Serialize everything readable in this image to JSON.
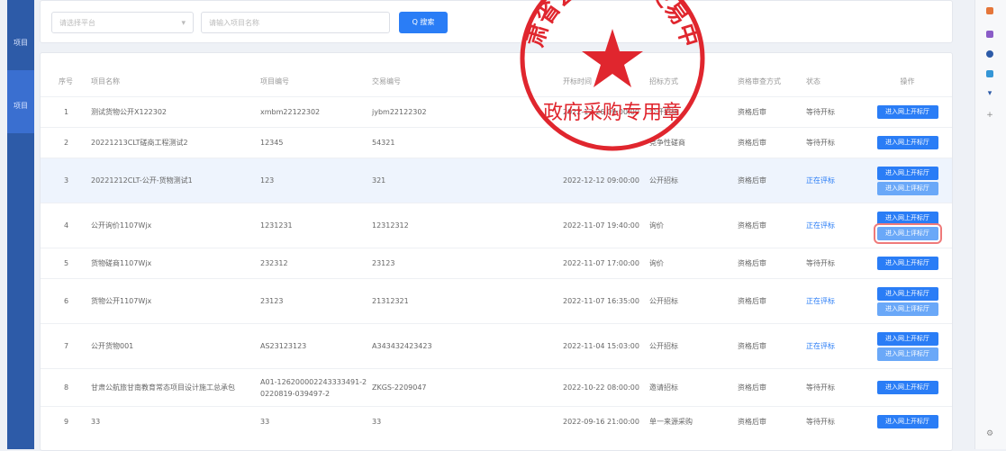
{
  "sidebar": {
    "labels": [
      "项目",
      "项目"
    ]
  },
  "search": {
    "platform_placeholder": "请选择平台",
    "name_placeholder": "请输入项目名称",
    "button": "Q 搜索"
  },
  "headers": [
    "序号",
    "项目名称",
    "项目编号",
    "交易编号",
    "开标时间",
    "招标方式",
    "资格审查方式",
    "状态",
    "操作"
  ],
  "rows": [
    {
      "no": "1",
      "name": "测试货物公开X122302",
      "code": "xmbm22122302",
      "tx": "jybm22122302",
      "time": "2022-12-26 09:00:00",
      "method": "公开招标",
      "review": "资格后审",
      "status": "等待开标",
      "buttons": [
        "进入网上开标厅"
      ]
    },
    {
      "no": "2",
      "name": "20221213CLT磋商工程测试2",
      "code": "12345",
      "tx": "54321",
      "time": "",
      "method": "竞争性磋商",
      "review": "资格后审",
      "status": "等待开标",
      "buttons": [
        "进入网上开标厅"
      ]
    },
    {
      "no": "3",
      "name": "20221212CLT-公开-货物测试1",
      "code": "123",
      "tx": "321",
      "time": "2022-12-12 09:00:00",
      "method": "公开招标",
      "review": "资格后审",
      "status": "正在评标",
      "buttons": [
        "进入网上开标厅",
        "进入网上评标厅"
      ]
    },
    {
      "no": "4",
      "name": "公开询价1107Wjx",
      "code": "1231231",
      "tx": "12312312",
      "time": "2022-11-07 19:40:00",
      "method": "询价",
      "review": "资格后审",
      "status": "正在评标",
      "buttons": [
        "进入网上开标厅",
        "进入网上评标厅"
      ]
    },
    {
      "no": "5",
      "name": "货物磋商1107Wjx",
      "code": "232312",
      "tx": "23123",
      "time": "2022-11-07 17:00:00",
      "method": "询价",
      "review": "资格后审",
      "status": "等待开标",
      "buttons": [
        "进入网上开标厅"
      ]
    },
    {
      "no": "6",
      "name": "货物公开1107Wjx",
      "code": "23123",
      "tx": "21312321",
      "time": "2022-11-07 16:35:00",
      "method": "公开招标",
      "review": "资格后审",
      "status": "正在评标",
      "buttons": [
        "进入网上开标厅",
        "进入网上评标厅"
      ]
    },
    {
      "no": "7",
      "name": "公开货物001",
      "code": "AS23123123",
      "tx": "A343432423423",
      "time": "2022-11-04 15:03:00",
      "method": "公开招标",
      "review": "资格后审",
      "status": "正在评标",
      "buttons": [
        "进入网上开标厅",
        "进入网上评标厅"
      ]
    },
    {
      "no": "8",
      "name": "甘肃公航旅甘南教育常态项目设计施工总承包",
      "code": "A01-126200002243333491-20220819-039497-2",
      "tx": "ZKGS-2209047",
      "time": "2022-10-22 08:00:00",
      "method": "邀请招标",
      "review": "资格后审",
      "status": "等待开标",
      "buttons": [
        "进入网上开标厅"
      ]
    },
    {
      "no": "9",
      "name": "33",
      "code": "33",
      "tx": "33",
      "time": "2022-09-16 21:00:00",
      "method": "单一来源采购",
      "review": "资格后审",
      "status": "等待开标",
      "buttons": [
        "进入网上开标厅"
      ]
    }
  ],
  "seal": {
    "top_text": "甘肃省公共资源交易中心",
    "bottom_text": "政府采购专用章"
  },
  "colors": {
    "primary": "#2a7df6",
    "seal": "#e0262e",
    "sidebar": "#2d5ba8"
  }
}
